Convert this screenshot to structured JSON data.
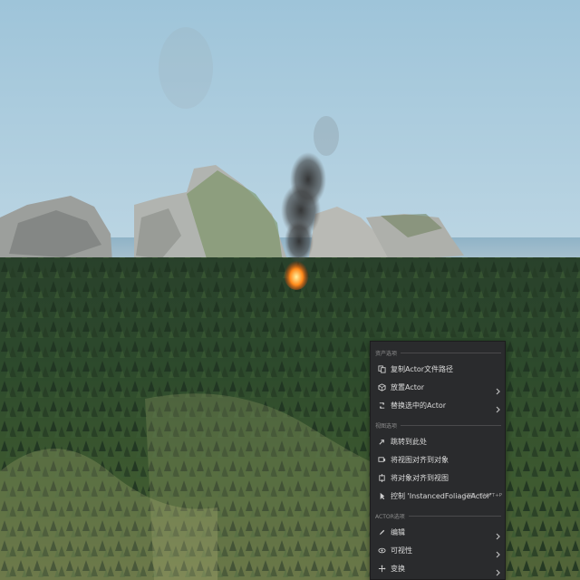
{
  "menu": {
    "sections": [
      {
        "title": "资产选项",
        "items": [
          {
            "label": "复制Actor文件路径",
            "icon": "copy-icon",
            "submenu": false
          },
          {
            "label": "放置Actor",
            "icon": "place-actor-icon",
            "submenu": true
          },
          {
            "label": "替换选中的Actor",
            "icon": "replace-icon",
            "submenu": true
          }
        ]
      },
      {
        "title": "视图选项",
        "items": [
          {
            "label": "跳转到此处",
            "icon": "jump-icon",
            "submenu": false
          },
          {
            "label": "将视图对齐到对象",
            "icon": "snap-view-icon",
            "submenu": false
          },
          {
            "label": "将对象对齐到视图",
            "icon": "snap-object-icon",
            "submenu": false
          },
          {
            "label": "控制 'InstancedFoliageActor'",
            "icon": "pilot-icon",
            "submenu": false,
            "shortcut": "CTRL+SHIFT+P"
          }
        ]
      },
      {
        "title": "ACTOR选项",
        "items": [
          {
            "label": "编辑",
            "icon": "edit-icon",
            "submenu": true
          },
          {
            "label": "可视性",
            "icon": "visibility-icon",
            "submenu": true
          },
          {
            "label": "变换",
            "icon": "transform-icon",
            "submenu": true
          }
        ]
      }
    ]
  }
}
